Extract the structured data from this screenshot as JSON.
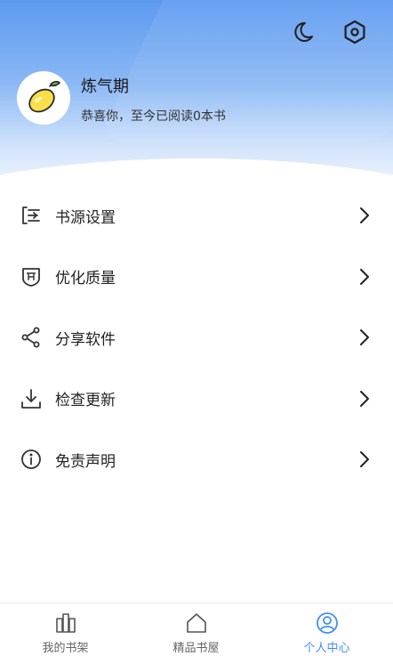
{
  "header": {
    "level": "炼气期",
    "greeting": "恭喜你，至今已阅读0本书",
    "night_mode_icon": "moon-icon",
    "settings_icon": "settings-hexagon-icon",
    "avatar_icon": "lemon-icon"
  },
  "menu": [
    {
      "label": "书源设置",
      "icon": "book-source-icon"
    },
    {
      "label": "优化质量",
      "icon": "shield-badge-icon"
    },
    {
      "label": "分享软件",
      "icon": "share-icon"
    },
    {
      "label": "检查更新",
      "icon": "download-icon"
    },
    {
      "label": "免责声明",
      "icon": "info-icon"
    }
  ],
  "tabs": [
    {
      "label": "我的书架",
      "icon": "bookshelf-icon",
      "active": false
    },
    {
      "label": "精品书屋",
      "icon": "house-icon",
      "active": false
    },
    {
      "label": "个人中心",
      "icon": "user-circle-icon",
      "active": true
    }
  ],
  "colors": {
    "accent": "#3e8ef7",
    "header_top": "#5d9af0",
    "header_bottom": "#eef4fe",
    "text_primary": "#222222"
  }
}
